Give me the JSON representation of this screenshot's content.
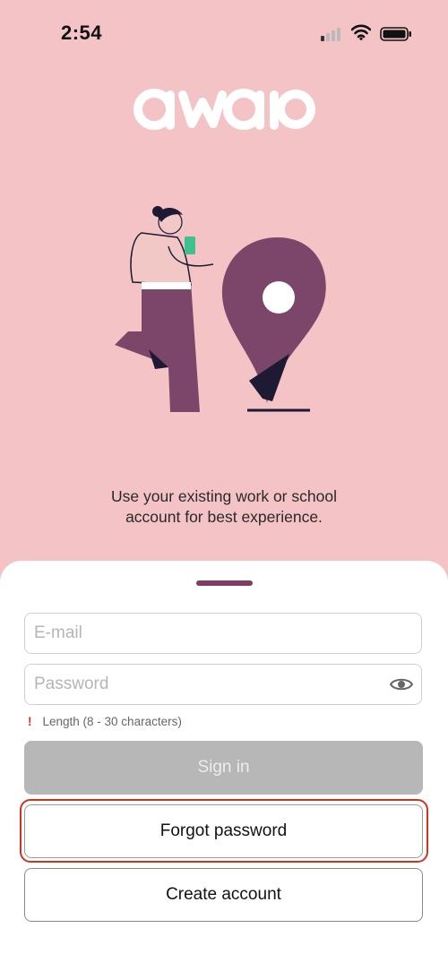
{
  "status_bar": {
    "time": "2:54",
    "icons": [
      "signal-icon",
      "wifi-icon",
      "battery-icon"
    ]
  },
  "brand": {
    "logo_text": "awaio",
    "accent_color": "#7c3f61",
    "background_color": "#f3c3c5"
  },
  "info": {
    "line1": "Use your existing work or school",
    "line2": "account for best experience."
  },
  "form": {
    "email_placeholder": "E-mail",
    "password_placeholder": "Password",
    "password_hint": "Length (8 - 30 characters)",
    "hint_icon": "!"
  },
  "buttons": {
    "sign_in": "Sign in",
    "forgot_password": "Forgot password",
    "create_account": "Create account"
  }
}
